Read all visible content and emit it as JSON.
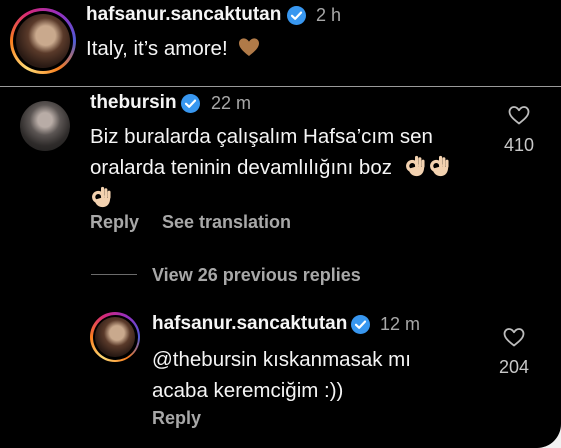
{
  "post_comment": {
    "username": "hafsanur.sancaktutan",
    "time": "2 h",
    "text": "Italy, it’s amore!",
    "emoji": "brown-heart"
  },
  "comment": {
    "username": "thebursin",
    "time": "22 m",
    "line1": "Biz buralarda çalışalım Hafsa’cım sen",
    "line2": "oralarda teninin devamlılığını boz",
    "emoji": "ok-hand",
    "like_count": "410",
    "reply_label": "Reply",
    "translate_label": "See translation"
  },
  "view_replies_label": "View 26 previous replies",
  "reply": {
    "username": "hafsanur.sancaktutan",
    "time": "12 m",
    "line1": "@thebursin kıskanmasak mı",
    "line2": "acaba keremciğim :))",
    "like_count": "204",
    "reply_label": "Reply"
  },
  "colors": {
    "background": "#000000",
    "primary_text": "#f5f5f5",
    "secondary_text": "#a8a8a8",
    "verified": "#3897f0"
  }
}
